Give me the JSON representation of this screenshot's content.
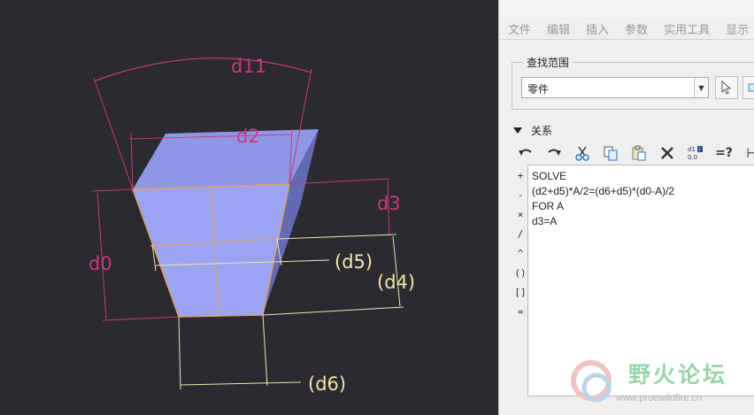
{
  "viewport": {
    "dimensions": {
      "d11": "d11",
      "d2": "d2",
      "d3": "d3",
      "d0": "d0",
      "d5": "(d5)",
      "d4": "(d4)",
      "d6": "(d6)"
    },
    "colors": {
      "background": "#2a2a30",
      "face_front": "#9aa3f0",
      "face_top": "#8f98e6",
      "face_side": "#646bb4",
      "edge_highlight": "#e0a060",
      "dim_driving": "#c93a7e",
      "dim_reference": "#f2e6a6"
    }
  },
  "menubar": {
    "items": [
      "文件",
      "编辑",
      "插入",
      "参数",
      "实用工具",
      "显示"
    ]
  },
  "search": {
    "legend": "查找范围",
    "scope_value": "零件"
  },
  "relations": {
    "header": "关系",
    "toolbar": [
      {
        "name": "undo-icon",
        "glyph": "↶"
      },
      {
        "name": "redo-icon",
        "glyph": "↷"
      },
      {
        "name": "cut-icon",
        "glyph": "✂"
      },
      {
        "name": "copy-icon",
        "glyph": "❐"
      },
      {
        "name": "paste-icon",
        "glyph": "📋"
      },
      {
        "name": "delete-icon",
        "glyph": "✕"
      },
      {
        "name": "dim-value-icon",
        "glyph": "d1"
      },
      {
        "name": "evaluate-icon",
        "glyph": "=?"
      },
      {
        "name": "insert-param-icon",
        "glyph": "⊢"
      }
    ],
    "operators": [
      "+",
      "-",
      "×",
      "/",
      "^",
      "()",
      "[]",
      "="
    ],
    "lines": [
      "SOLVE",
      "(d2+d5)*A/2=(d6+d5)*(d0-A)/2",
      "FOR A",
      "d3=A"
    ]
  },
  "watermark": {
    "title": "野火论坛",
    "url": "www.proewildfire.cn"
  }
}
